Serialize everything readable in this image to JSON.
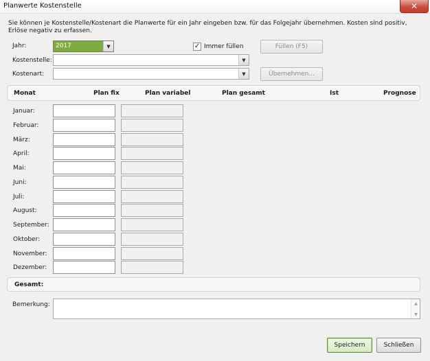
{
  "window": {
    "title": "Planwerte Kostenstelle",
    "close_glyph": "✕"
  },
  "info_text": "Sie können je Kostenstelle/Kostenart die Planwerte für ein Jahr eingeben bzw. für das Folgejahr übernehmen. Kosten sind positiv, Erlöse negativ zu erfassen.",
  "form": {
    "year_label": "Jahr:",
    "year_value": "2017",
    "always_fill_label": "Immer füllen",
    "always_fill_checked": "✓",
    "fill_button": "Füllen (F5)",
    "cost_center_label": "Kostenstelle:",
    "cost_type_label": "Kostenart:",
    "apply_button": "Übernehmen...",
    "dropdown_glyph": "▼"
  },
  "columns": {
    "month": "Monat",
    "plan_fix": "Plan fix",
    "plan_variable": "Plan variabel",
    "plan_total": "Plan gesamt",
    "actual": "Ist",
    "forecast": "Prognose"
  },
  "months": [
    "Januar:",
    "Februar:",
    "März:",
    "April:",
    "Mai:",
    "Juni:",
    "Juli:",
    "August:",
    "September:",
    "Oktober:",
    "November:",
    "Dezember:"
  ],
  "total_label": "Gesamt:",
  "remark_label": "Bemerkung:",
  "scroll": {
    "up": "▲",
    "down": "▼"
  },
  "buttons": {
    "save": "Speichern",
    "close": "Schließen"
  },
  "colors": {
    "year_field_bg": "#7faa41",
    "save_border": "#5e8a3b"
  }
}
